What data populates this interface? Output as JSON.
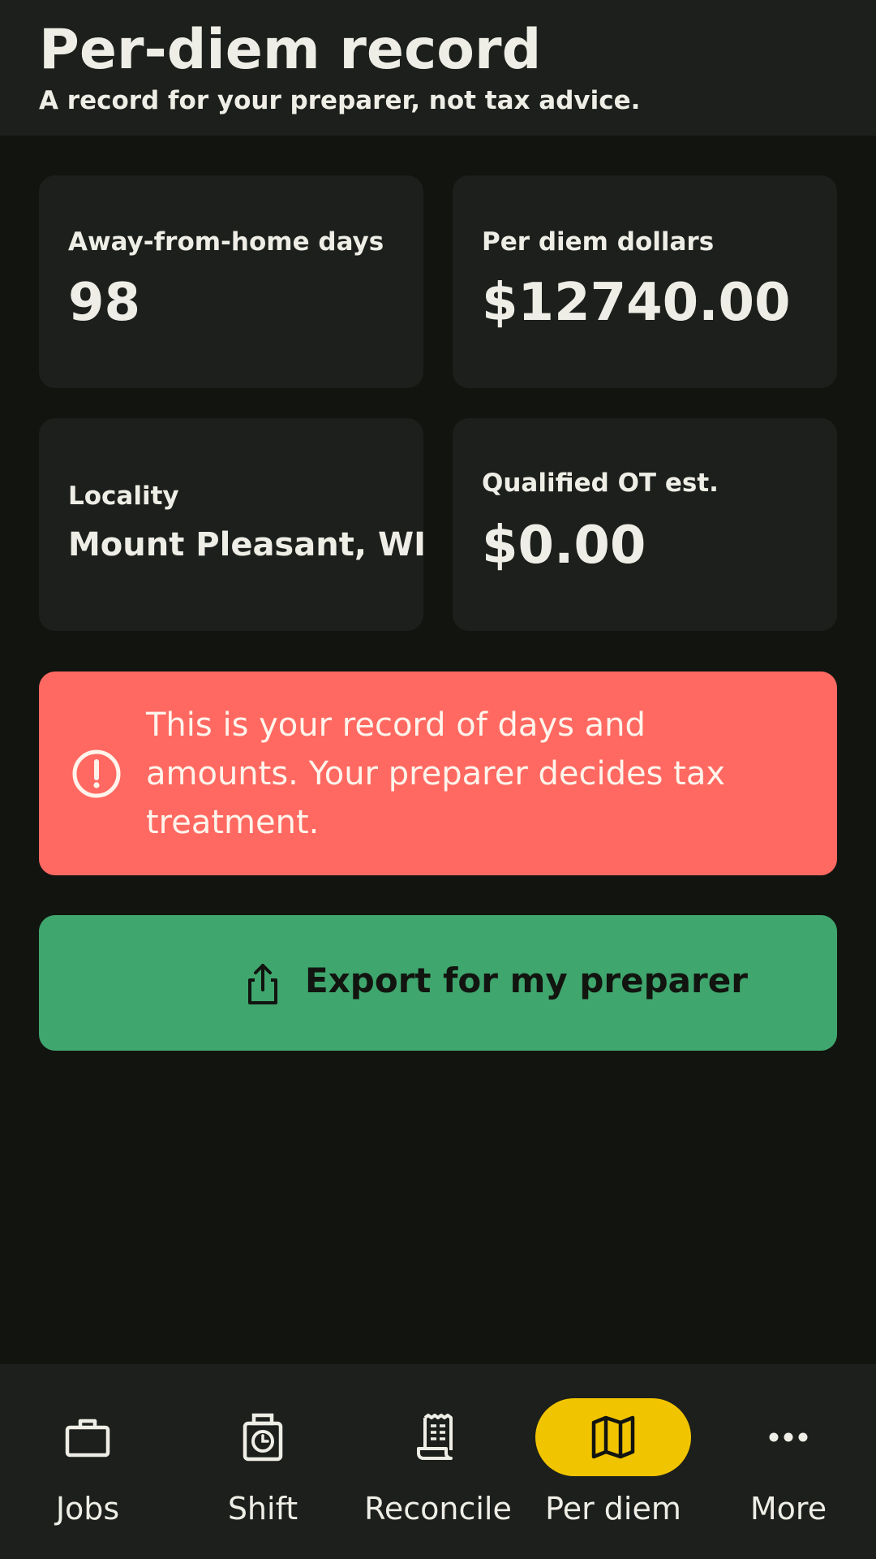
{
  "header": {
    "title": "Per-diem record",
    "subtitle": "A record for your preparer, not tax advice."
  },
  "cards": {
    "days": {
      "label": "Away-from-home days",
      "value": "98"
    },
    "dollars": {
      "label": "Per diem dollars",
      "value": "$12740.00"
    },
    "locality": {
      "label": "Locality",
      "value": "Mount Pleasant, WI"
    },
    "ot": {
      "label": "Qualified OT est.",
      "value": "$0.00"
    }
  },
  "notice": {
    "text": "This is your record of days and amounts. Your preparer decides tax treatment.",
    "icon": "alert-circle-icon"
  },
  "export": {
    "label": "Export for my preparer",
    "icon": "share-upload-icon"
  },
  "nav": {
    "items": [
      {
        "label": "Jobs",
        "icon": "briefcase-icon",
        "active": false
      },
      {
        "label": "Shift",
        "icon": "timer-clock-icon",
        "active": false
      },
      {
        "label": "Reconcile",
        "icon": "receipt-icon",
        "active": false
      },
      {
        "label": "Per diem",
        "icon": "map-icon",
        "active": true
      },
      {
        "label": "More",
        "icon": "more-dots-icon",
        "active": false
      }
    ]
  },
  "colors": {
    "background": "#121410",
    "surface": "#1C1F1B",
    "text": "#EEEEE6",
    "alert": "#FF6961",
    "primary_action": "#3FA66D",
    "active_nav": "#F1C400"
  }
}
